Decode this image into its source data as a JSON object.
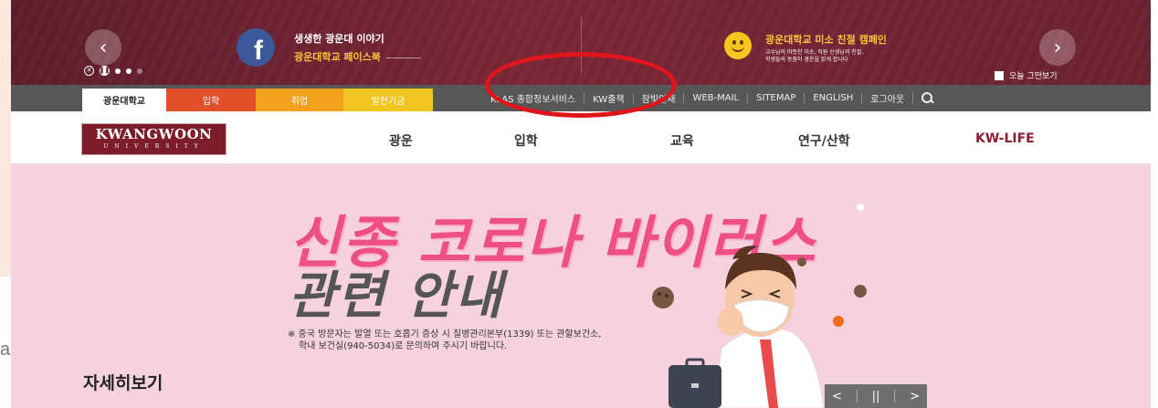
{
  "promo": {
    "facebook_line1": "생생한 광운대 이야기",
    "facebook_line2": "광운대학교 페이스북",
    "campaign_title": "광운대학교 미소 친절 캠페인",
    "campaign_desc_line1": "교수님의 따뜻한 미소, 직원 선생님의 친절,",
    "campaign_desc_line2": "학생들의 동참이 광운을 밝게 합니다",
    "today_hide": "오늘 그만보기",
    "facebook_glyph": "f"
  },
  "tabs": [
    "광운대학교",
    "입학",
    "취업",
    "발전기금"
  ],
  "util_links": [
    "KLAS 종합정보서비스",
    "KW출책",
    "참빛인재",
    "WEB-MAIL",
    "SITEMAP",
    "ENGLISH",
    "로그아웃"
  ],
  "logo": {
    "name": "KWANGWOON",
    "sub": "UNIVERSITY"
  },
  "nav": [
    "광운",
    "입학",
    "교육",
    "연구/산학",
    "KW-LIFE"
  ],
  "hero": {
    "title_line1": "신종 코로나 바이러스",
    "title_line2": "관련 안내",
    "notice_line1": "※ 중국 방문자는 발열 또는 호흡기 증상 시 질병관리본부(1339) 또는 관할보건소,",
    "notice_line2": "학내 보건실(940-5034)로 문의하여 주시기 바랍니다.",
    "more": "자세히보기"
  },
  "stray_text": "a",
  "colors": {
    "banner": "#6b2231",
    "admission_tab": "#e2502a",
    "jobs_tab": "#f4a21d",
    "fund_tab": "#f0c51f",
    "hero_bg": "#f6d2df",
    "hero_title": "#ef4f87",
    "annotation": "#e0141b"
  }
}
